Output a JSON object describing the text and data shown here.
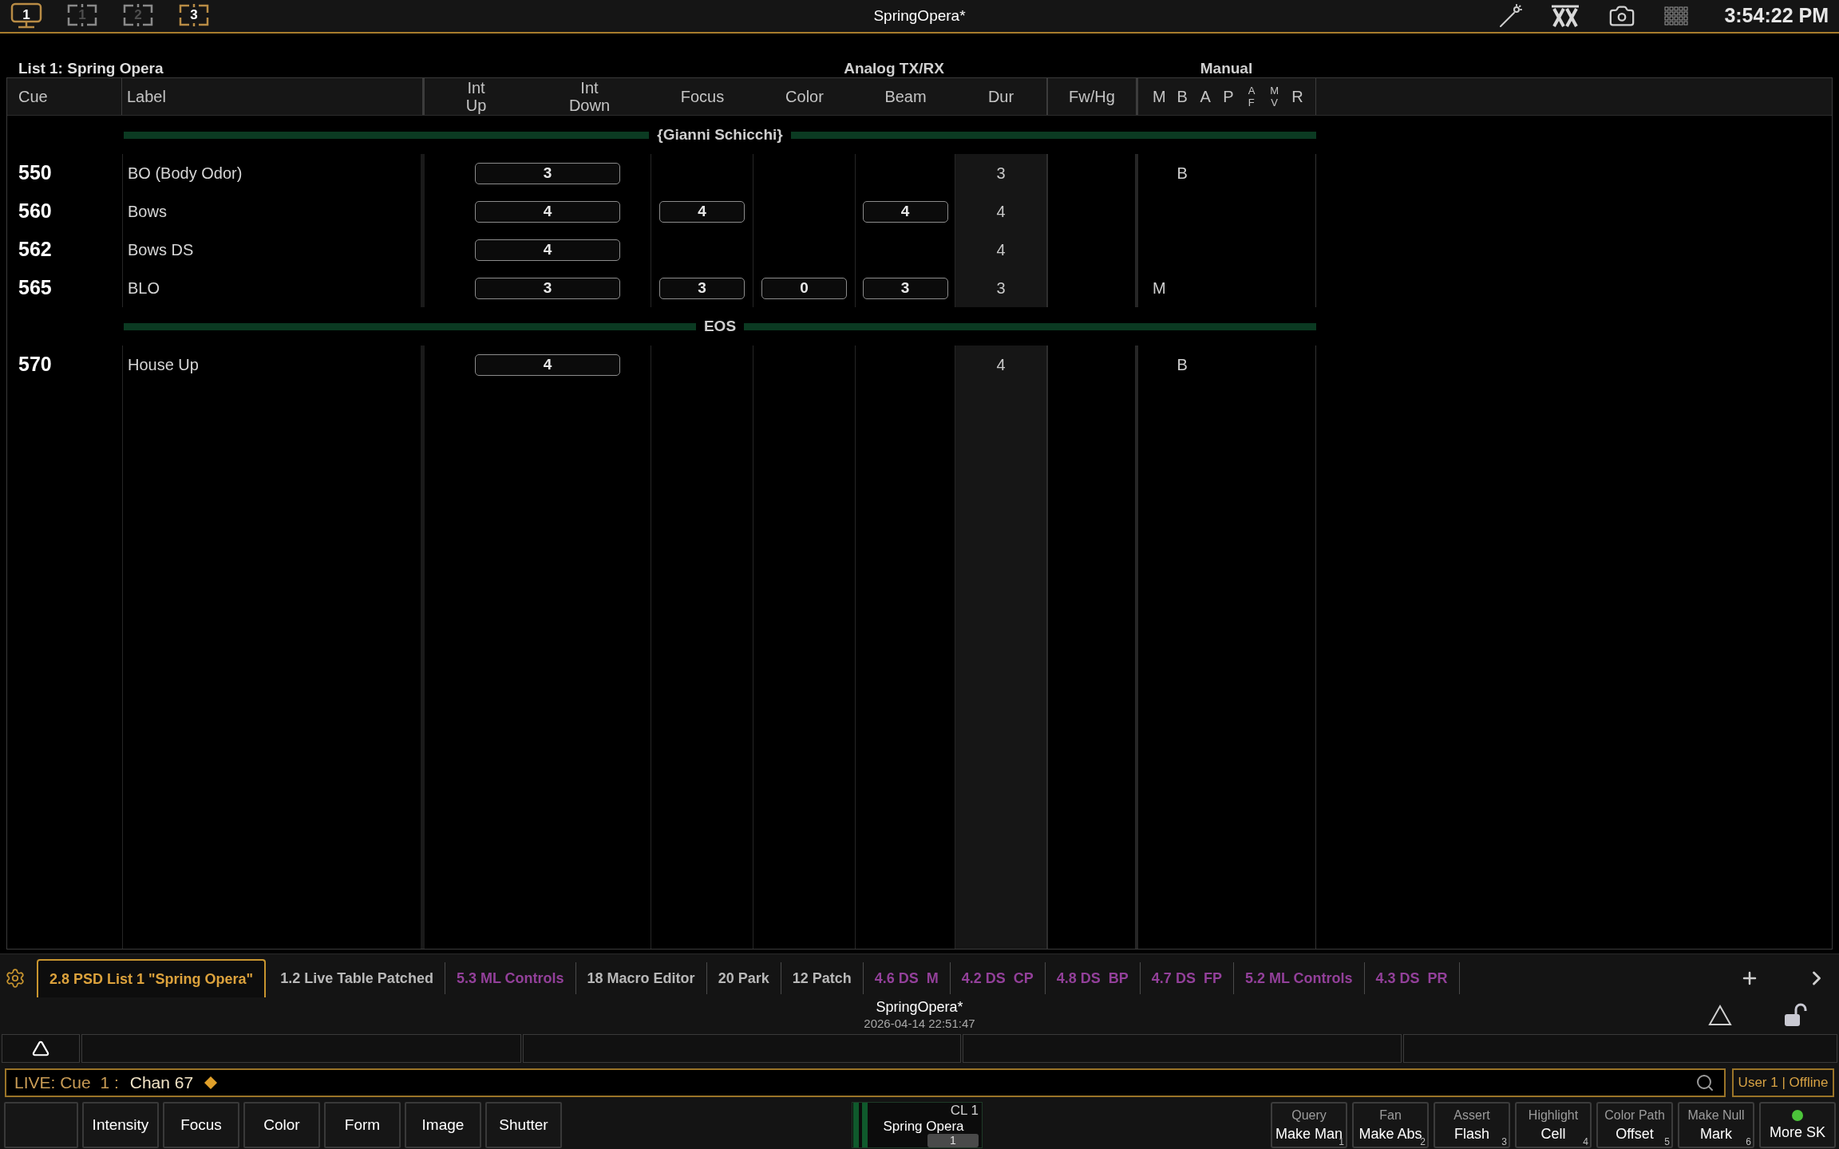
{
  "top_bar": {
    "screens": [
      {
        "label": "1",
        "kind": "monitor",
        "selected": true
      },
      {
        "label": "1",
        "kind": "frame",
        "selected": false
      },
      {
        "label": "2",
        "kind": "frame",
        "selected": false
      },
      {
        "label": "3",
        "kind": "frame",
        "selected": true
      }
    ],
    "title": "SpringOpera*",
    "time": "3:54:22 PM"
  },
  "cue_list": {
    "title": "List 1: Spring Opera",
    "group_labels": [
      "Analog TX/RX",
      "Manual"
    ],
    "columns": [
      "Cue",
      "Label",
      "Int Up",
      "Int Down",
      "Focus",
      "Color",
      "Beam",
      "Dur",
      "Fw/Hg"
    ],
    "flag_columns": [
      "M",
      "B",
      "A",
      "P",
      "A F",
      "M V",
      "R"
    ],
    "rows": [
      {
        "kind": "part",
        "label": "{Gianni Schicchi}"
      },
      {
        "kind": "cue",
        "cue": "550",
        "label": "BO (Body Odor)",
        "intensity_time": "3",
        "dur": "3",
        "flags": {
          "b": "B"
        }
      },
      {
        "kind": "cue",
        "cue": "560",
        "label": "Bows",
        "intensity_time": "4",
        "focus_time": "4",
        "beam_time": "4",
        "dur": "4"
      },
      {
        "kind": "cue",
        "cue": "562",
        "label": "Bows DS",
        "intensity_time": "4",
        "dur": "4"
      },
      {
        "kind": "cue",
        "cue": "565",
        "label": "BLO",
        "intensity_time": "3",
        "focus_time": "3",
        "color_time": "0",
        "beam_time": "3",
        "dur": "3",
        "flags": {
          "m": "M"
        }
      },
      {
        "kind": "part",
        "label": "EOS"
      },
      {
        "kind": "cue",
        "cue": "570",
        "label": "House Up",
        "intensity_time": "4",
        "dur": "4",
        "flags": {
          "b": "B"
        }
      }
    ]
  },
  "tabs": [
    {
      "label": "2.8 PSD List 1 \"Spring Opera\"",
      "selected": true,
      "color": "#dca23c"
    },
    {
      "label": "1.2 Live Table Patched",
      "selected": false,
      "color": "#b8b8b8"
    },
    {
      "label": "5.3 ML Controls",
      "selected": false,
      "color": "#93409a"
    },
    {
      "label": "18 Macro Editor",
      "selected": false,
      "color": "#b8b8b8"
    },
    {
      "label": "20 Park",
      "selected": false,
      "color": "#b8b8b8"
    },
    {
      "label": "12 Patch",
      "selected": false,
      "color": "#b8b8b8"
    },
    {
      "label": "4.6 DS  M",
      "selected": false,
      "color": "#93409a"
    },
    {
      "label": "4.2 DS  CP",
      "selected": false,
      "color": "#93409a"
    },
    {
      "label": "4.8 DS  BP",
      "selected": false,
      "color": "#93409a"
    },
    {
      "label": "4.7 DS  FP",
      "selected": false,
      "color": "#93409a"
    },
    {
      "label": "5.2 ML Controls",
      "selected": false,
      "color": "#93409a"
    },
    {
      "label": "4.3 DS  PR",
      "selected": false,
      "color": "#93409a"
    }
  ],
  "show": {
    "name": "SpringOpera*",
    "saved": "2026-04-14 22:51:47"
  },
  "command_line": {
    "mode": "LIVE: Cue  1 :",
    "command": "Chan 67"
  },
  "user": "User 1 | Offline",
  "category_buttons": [
    "Intensity",
    "Focus",
    "Color",
    "Form",
    "Image",
    "Shutter"
  ],
  "fader": {
    "label": "CL 1",
    "name": "Spring Opera",
    "value": "1"
  },
  "softkeys": [
    {
      "top": "Query",
      "label": "Make Man",
      "number": "1"
    },
    {
      "top": "Fan",
      "label": "Make Abs",
      "number": "2"
    },
    {
      "top": "Assert",
      "label": "Flash",
      "number": "3"
    },
    {
      "top": "Highlight",
      "label": "Cell",
      "number": "4"
    },
    {
      "top": "Color Path",
      "label": "Offset",
      "number": "5"
    },
    {
      "top": "Make Null",
      "label": "Mark",
      "number": "6"
    },
    {
      "label": "More SK",
      "led": true
    }
  ]
}
